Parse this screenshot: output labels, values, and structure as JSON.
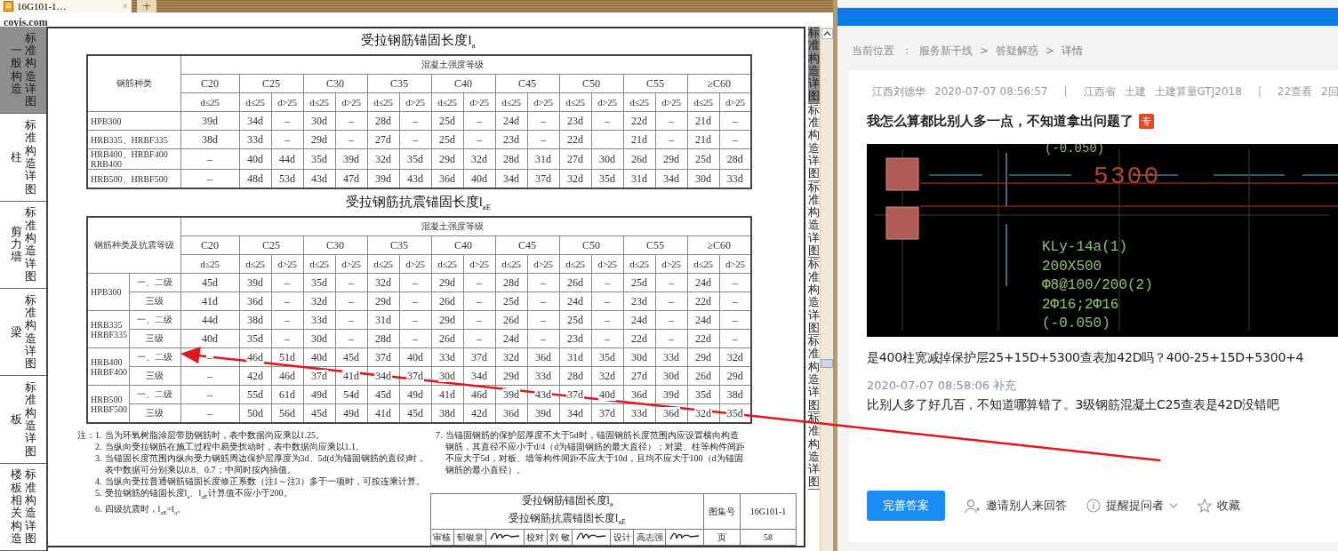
{
  "viewer": {
    "browser_tabs": [
      {
        "label": "16G101-1…",
        "close": "×",
        "selected": true
      }
    ],
    "new_tab": "+",
    "site_logo": "coyis.com",
    "left_tabs": [
      {
        "label": "一般构造",
        "sublabel": "标准构造详图",
        "selected": true
      },
      {
        "label": "柱",
        "sublabel": "标准构造详图",
        "selected": false
      },
      {
        "label": "剪力墙",
        "sublabel": "标准构造详图",
        "selected": false
      },
      {
        "label": "梁",
        "sublabel": "标准构造详图",
        "selected": false
      },
      {
        "label": "板",
        "sublabel": "标准构造详图",
        "selected": false
      },
      {
        "label": "楼板相关构造",
        "sublabel": "标准构造详图",
        "selected": false
      }
    ],
    "right_tabs": [
      {
        "label": "标准构造详图",
        "selected": true
      },
      {
        "label": "标准构造详图",
        "selected": false
      },
      {
        "label": "标准构造详图",
        "selected": false
      },
      {
        "label": "标准构造详图",
        "selected": false
      },
      {
        "label": "标准构造详图",
        "selected": false
      },
      {
        "label": "标准构造详图",
        "selected": false
      }
    ],
    "document": {
      "table_1": {
        "title": "受拉钢筋锚固长度l$_{a}$",
        "row_header": "钢筋种类",
        "group_header": "混凝土强度等级",
        "grades": [
          {
            "label": "C20",
            "columns": [
              "d≤25"
            ]
          },
          {
            "label": "C25",
            "columns": [
              "d≤25",
              "d>25"
            ]
          },
          {
            "label": "C30",
            "columns": [
              "d≤25",
              "d>25"
            ]
          },
          {
            "label": "C35",
            "columns": [
              "d≤25",
              "d>25"
            ]
          },
          {
            "label": "C40",
            "columns": [
              "d≤25",
              "d>25"
            ]
          },
          {
            "label": "C45",
            "columns": [
              "d≤25",
              "d>25"
            ]
          },
          {
            "label": "C50",
            "columns": [
              "d≤25",
              "d>25"
            ]
          },
          {
            "label": "C55",
            "columns": [
              "d≤25",
              "d>25"
            ]
          },
          {
            "label": "≥C60",
            "columns": [
              "d≤25",
              "d>25"
            ]
          }
        ],
        "rows": [
          {
            "label_lines": [
              "HPB300"
            ],
            "cells": [
              "39d",
              "34d",
              "–",
              "30d",
              "–",
              "28d",
              "–",
              "25d",
              "–",
              "24d",
              "–",
              "23d",
              "–",
              "22d",
              "–",
              "21d",
              "–"
            ]
          },
          {
            "label_lines": [
              "HRB335、HRBF335"
            ],
            "cells": [
              "38d",
              "33d",
              "–",
              "29d",
              "–",
              "27d",
              "–",
              "25d",
              "–",
              "23d",
              "–",
              "22d",
              null,
              "21d",
              "–",
              "21d",
              "–"
            ]
          },
          {
            "label_lines": [
              "HRB400、HRBF400",
              "RRB400"
            ],
            "cells": [
              "–",
              "40d",
              "44d",
              "35d",
              "39d",
              "32d",
              "35d",
              "29d",
              "32d",
              "28d",
              "31d",
              "27d",
              "30d",
              "26d",
              "29d",
              "25d",
              "28d"
            ]
          },
          {
            "label_lines": [
              "HRB500、HRBF500"
            ],
            "cells": [
              "–",
              "48d",
              "53d",
              "43d",
              "47d",
              "39d",
              "43d",
              "36d",
              "40d",
              "34d",
              "37d",
              "32d",
              "35d",
              "31d",
              "34d",
              "30d",
              "33d"
            ]
          }
        ]
      },
      "table_2": {
        "title": "受拉钢筋抗震锚固长度l$_{aE}$",
        "row_header": "钢筋种类及抗震等级",
        "group_header": "混凝土强度等级",
        "grades": [
          {
            "label": "C20",
            "columns": [
              "d≤25"
            ]
          },
          {
            "label": "C25",
            "columns": [
              "d≤25",
              "d>25"
            ]
          },
          {
            "label": "C30",
            "columns": [
              "d≤25",
              "d>25"
            ]
          },
          {
            "label": "C35",
            "columns": [
              "d≤25",
              "d>25"
            ]
          },
          {
            "label": "C40",
            "columns": [
              "d≤25",
              "d>25"
            ]
          },
          {
            "label": "C45",
            "columns": [
              "d≤25",
              "d>25"
            ]
          },
          {
            "label": "C50",
            "columns": [
              "d≤25",
              "d>25"
            ]
          },
          {
            "label": "C55",
            "columns": [
              "d≤25",
              "d>25"
            ]
          },
          {
            "label": "≥C60",
            "columns": [
              "d≤25",
              "d>25"
            ]
          }
        ],
        "rows": [
          {
            "label_lines": [
              "HPB300"
            ],
            "levels": [
              {
                "label": "一、二级",
                "cells": [
                  "45d",
                  "39d",
                  "–",
                  "35d",
                  "–",
                  "32d",
                  "–",
                  "29d",
                  "–",
                  "28d",
                  "–",
                  "26d",
                  "–",
                  "25d",
                  "–",
                  "24d",
                  "–"
                ]
              },
              {
                "label": "三级",
                "cells": [
                  "41d",
                  "36d",
                  "–",
                  "32d",
                  "–",
                  "29d",
                  "–",
                  "26d",
                  "–",
                  "25d",
                  "–",
                  "24d",
                  "–",
                  "23d",
                  "–",
                  "22d",
                  "–"
                ]
              }
            ]
          },
          {
            "label_lines": [
              "HRB335",
              "HRBF335"
            ],
            "levels": [
              {
                "label": "一、二级",
                "cells": [
                  "44d",
                  "38d",
                  "–",
                  "33d",
                  "–",
                  "31d",
                  "–",
                  "29d",
                  "–",
                  "26d",
                  "–",
                  "25d",
                  "–",
                  "24d",
                  "–",
                  "24d",
                  "–"
                ]
              },
              {
                "label": "三级",
                "cells": [
                  "40d",
                  "35d",
                  "–",
                  "30d",
                  "–",
                  "28d",
                  "–",
                  "26d",
                  "–",
                  "24d",
                  "–",
                  "23d",
                  "–",
                  "22d",
                  "–",
                  "22d",
                  "–"
                ]
              }
            ]
          },
          {
            "label_lines": [
              "HRB400",
              "HRBF400"
            ],
            "levels": [
              {
                "label": "一、二级",
                "cells": [
                  "–",
                  "46d",
                  "51d",
                  "40d",
                  "45d",
                  "37d",
                  "40d",
                  "33d",
                  "37d",
                  "32d",
                  "36d",
                  "31d",
                  "35d",
                  "30d",
                  "33d",
                  "29d",
                  "32d"
                ]
              },
              {
                "label": "三级",
                "cells": [
                  "–",
                  "42d",
                  "46d",
                  "37d",
                  "41d",
                  "34d",
                  "37d",
                  "30d",
                  "34d",
                  "29d",
                  "33d",
                  "28d",
                  "32d",
                  "27d",
                  "30d",
                  "26d",
                  "29d"
                ]
              }
            ]
          },
          {
            "label_lines": [
              "HRB500",
              "HRBF500"
            ],
            "levels": [
              {
                "label": "一、二级",
                "cells": [
                  "–",
                  "55d",
                  "61d",
                  "49d",
                  "54d",
                  "45d",
                  "49d",
                  "41d",
                  "46d",
                  "39d",
                  "43d",
                  "37d",
                  "40d",
                  "36d",
                  "39d",
                  "35d",
                  "38d"
                ]
              },
              {
                "label": "三级",
                "cells": [
                  "–",
                  "50d",
                  "56d",
                  "45d",
                  "49d",
                  "41d",
                  "45d",
                  "38d",
                  "42d",
                  "36d",
                  "39d",
                  "34d",
                  "37d",
                  "33d",
                  "36d",
                  "32d",
                  "35d"
                ]
              }
            ]
          }
        ]
      },
      "notes_label": "注：",
      "notes": [
        {
          "number": "1.",
          "text": "当为环氧树脂涂层带肋钢筋时，表中数据尚应乘以1.25。"
        },
        {
          "number": "2.",
          "text": "当纵向受拉钢筋在施工过程中易受扰动时，表中数据尚应乘以1.1。"
        },
        {
          "number": "3.",
          "text": "当锚固长度范围内纵向受力钢筋周边保护层厚度为3d、5d(d为锚固钢筋的直径)时，表中数据可分别乘以0.8、0.7；中间时按内插值。"
        },
        {
          "number": "4.",
          "text": "当纵向受拉普通钢筋锚固长度修正系数（注1～注3）多于一项时，可按连乘计算。"
        },
        {
          "number": "5.",
          "text": "受拉钢筋的锚固长度l$_{a}$、l$_{aE}$计算值不应小于200。"
        },
        {
          "number": "6.",
          "text": "四级抗震时，l$_{aE}$=l$_{a}$。"
        }
      ],
      "side_notes": [
        {
          "number": "7.",
          "text": "当锚固钢筋的保护层厚度不大于5d时，锚固钢筋长度范围内应设置横向构造钢筋，其直径不应小于d/4（d为锚固钢筋的最大直径）；对梁、柱等构件间距不应大于5d，对板、墙等构件间距不应大于10d，且均不应大于100（d为锚固钢筋的最小直径）。"
        }
      ],
      "title_block": {
        "titles": [
          "受拉钢筋锚固长度l$_{a}$",
          "受拉钢筋抗震锚固长度l$_{aE}$"
        ],
        "atlas_label": "图集号",
        "atlas_number": "16G101-1",
        "signoff": [
          {
            "role": "审核",
            "name": "郁银泉"
          },
          {
            "role": "校对",
            "name": "刘 敏"
          },
          {
            "role": "设计",
            "name": "高志强"
          }
        ],
        "page_label": "页",
        "page_number": "58"
      }
    }
  },
  "qa_page": {
    "breadcrumb": [
      {
        "kind": "label",
        "text": "当前位置"
      },
      {
        "kind": "separator",
        "text": "："
      },
      {
        "kind": "link",
        "text": "服务新干线"
      },
      {
        "kind": "separator",
        "text": ">"
      },
      {
        "kind": "link",
        "text": "答疑解惑"
      },
      {
        "kind": "separator",
        "text": ">"
      },
      {
        "kind": "current",
        "text": "详情"
      }
    ],
    "meta": [
      {
        "kind": "author",
        "text": "江西刘德华"
      },
      {
        "kind": "text",
        "text": "2020-07-07 08:56:57"
      },
      {
        "kind": "divider",
        "text": "|"
      },
      {
        "kind": "text",
        "text": "江西省"
      },
      {
        "kind": "text",
        "text": "土建"
      },
      {
        "kind": "text",
        "text": "土建算量GTJ2018"
      },
      {
        "kind": "divider",
        "text": "|"
      },
      {
        "kind": "text",
        "text": "22查看"
      },
      {
        "kind": "text",
        "text": "2回"
      }
    ],
    "title": "我怎么算都比别人多一点，不知道拿出问题了",
    "title_badge": "专",
    "drawing": {
      "elevation_top": "(-0.050)",
      "span": "5300",
      "beam_labels": [
        "KLy-14a(1)",
        "200X500",
        "Φ8@100/200(2)",
        "2Φ16;2Φ16",
        "(-0.050)"
      ]
    },
    "body": "是400柱宽减掉保护层25+15D+5300查表加42D吗？400-25+15D+5300+4",
    "supplement_time": "2020-07-07 08:58:06 补充",
    "supplement": "比别人多了好几百，不知道哪算错了。3级钢筋混凝土C25查表是42D没错吧",
    "actions": [
      {
        "kind": "primary",
        "label": "完善答案"
      },
      {
        "kind": "invite",
        "label": "邀请别人来回答"
      },
      {
        "kind": "remind",
        "label": "提醒提问者"
      },
      {
        "kind": "favorite",
        "label": "收藏"
      }
    ]
  }
}
